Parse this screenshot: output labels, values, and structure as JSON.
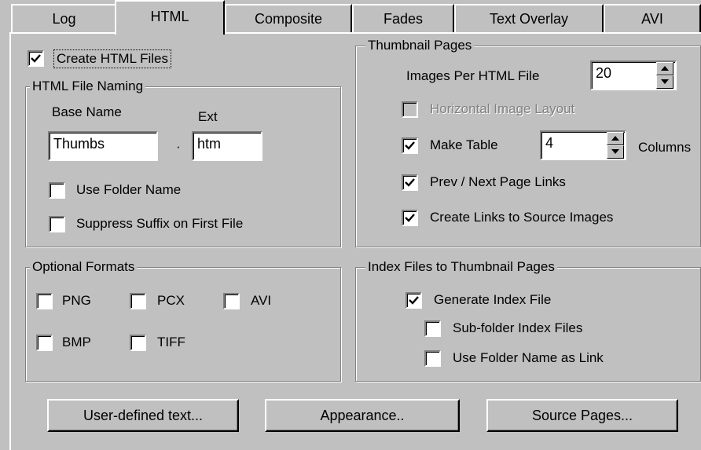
{
  "tabs": [
    {
      "label": "Log",
      "selected": false
    },
    {
      "label": "HTML",
      "selected": true
    },
    {
      "label": "Composite",
      "selected": false
    },
    {
      "label": "Fades",
      "selected": false
    },
    {
      "label": "Text Overlay",
      "selected": false
    },
    {
      "label": "AVI",
      "selected": false
    }
  ],
  "create_html": {
    "label": "Create HTML Files",
    "checked": true
  },
  "naming": {
    "title": "HTML File Naming",
    "base_name_label": "Base Name",
    "ext_label": "Ext",
    "separator": "·",
    "base_name_value": "Thumbs",
    "ext_value": "htm",
    "use_folder_name": {
      "label": "Use Folder Name",
      "checked": false
    },
    "suppress_suffix": {
      "label": "Suppress Suffix on First File",
      "checked": false
    }
  },
  "thumbnail_pages": {
    "title": "Thumbnail Pages",
    "images_per_file_label": "Images Per HTML File",
    "images_per_file_value": "20",
    "horizontal_layout": {
      "label": "Horizontal Image Layout",
      "checked": false,
      "enabled": false
    },
    "make_table": {
      "label": "Make Table",
      "checked": true
    },
    "columns_value": "4",
    "columns_label": "Columns",
    "prev_next": {
      "label": "Prev / Next Page Links",
      "checked": true
    },
    "source_links": {
      "label": "Create Links to Source Images",
      "checked": true
    }
  },
  "optional_formats": {
    "title": "Optional Formats",
    "png": {
      "label": "PNG",
      "checked": false
    },
    "pcx": {
      "label": "PCX",
      "checked": false
    },
    "avi": {
      "label": "AVI",
      "checked": false
    },
    "bmp": {
      "label": "BMP",
      "checked": false
    },
    "tiff": {
      "label": "TIFF",
      "checked": false
    }
  },
  "index_files": {
    "title": "Index Files to Thumbnail Pages",
    "generate_index": {
      "label": "Generate Index File",
      "checked": true
    },
    "subfolder_index": {
      "label": "Sub-folder Index Files",
      "checked": false
    },
    "folder_name_link": {
      "label": "Use Folder Name as Link",
      "checked": false
    }
  },
  "buttons": {
    "user_defined": "User-defined text...",
    "appearance": "Appearance..",
    "source_pages": "Source Pages..."
  },
  "icons": {
    "check": "check-mark-icon",
    "spin_up": "spin-up-arrow-icon",
    "spin_down": "spin-down-arrow-icon"
  },
  "colors": {
    "face": "#c0c0c0",
    "highlight": "#ffffff",
    "shadow": "#808080",
    "dark_shadow": "#000000",
    "disabled_text": "#808080"
  }
}
